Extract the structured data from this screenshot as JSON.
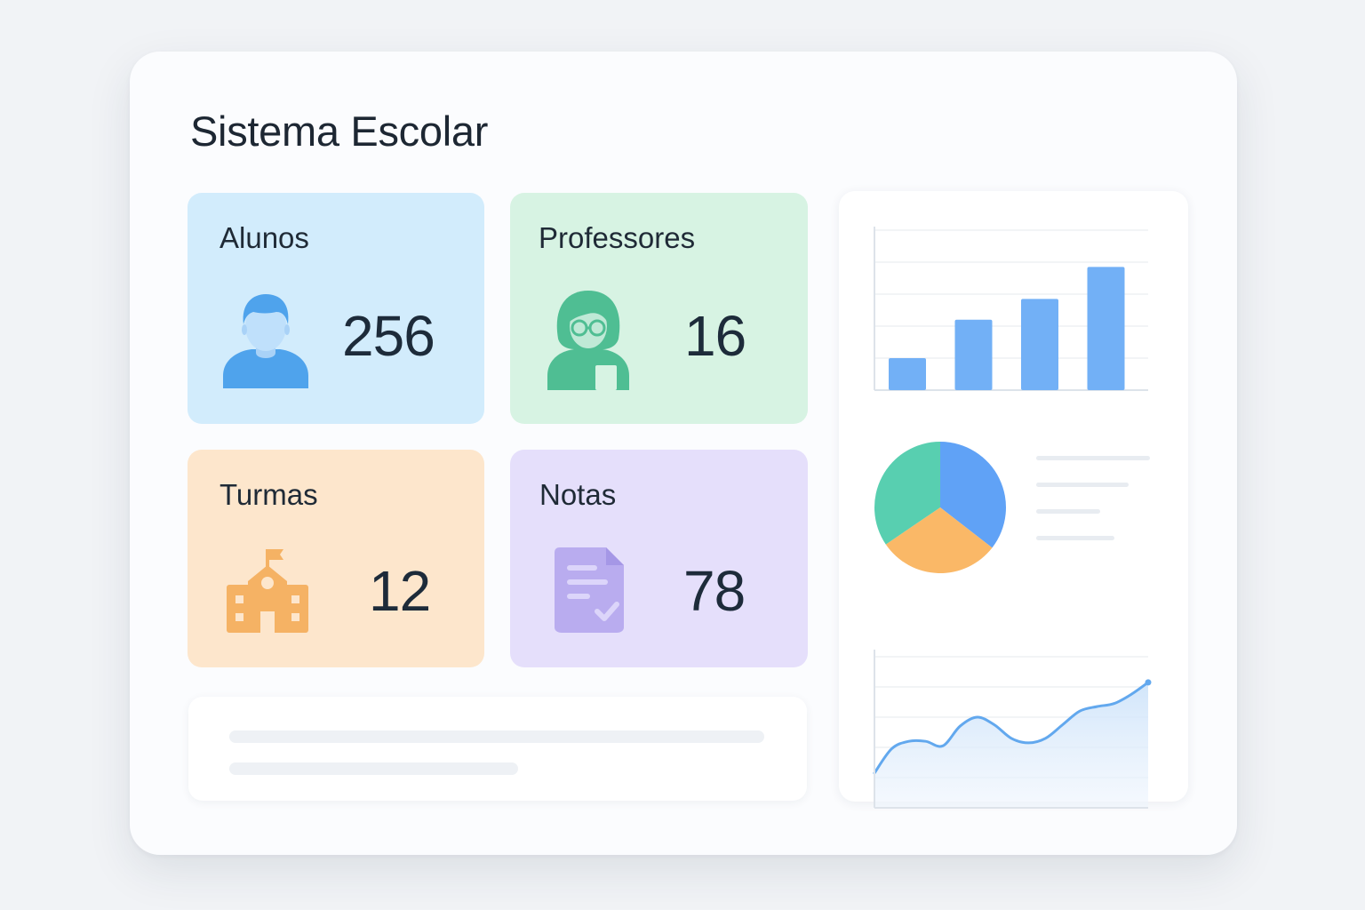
{
  "app": {
    "title": "Sistema Escolar"
  },
  "stats": [
    {
      "label": "Alunos",
      "value": "256",
      "icon": "student-icon",
      "bg": "#d2ecfc",
      "accent": "#4fa3ec"
    },
    {
      "label": "Professores",
      "value": "16",
      "icon": "teacher-icon",
      "bg": "#d7f3e3",
      "accent": "#4fbe93"
    },
    {
      "label": "Turmas",
      "value": "12",
      "icon": "school-icon",
      "bg": "#fde6cc",
      "accent": "#f5b264"
    },
    {
      "label": "Notas",
      "value": "78",
      "icon": "document-check-icon",
      "bg": "#e5dffb",
      "accent": "#b9acef"
    }
  ],
  "chart_data": [
    {
      "type": "bar",
      "categories": [
        "",
        "",
        "",
        ""
      ],
      "values": [
        20,
        44,
        57,
        77
      ],
      "ylim": [
        0,
        100
      ],
      "grid": true,
      "colors": [
        "#72b0f6"
      ]
    },
    {
      "type": "pie",
      "categories": [
        "",
        "",
        ""
      ],
      "values": [
        35.5,
        30,
        34.5
      ],
      "colors": [
        "#60a2f6",
        "#fab867",
        "#58cfb0"
      ],
      "legend": "right"
    },
    {
      "type": "area",
      "x": [
        0,
        1,
        2,
        3,
        4,
        5,
        6,
        7,
        8,
        9,
        10,
        11,
        12,
        13,
        14,
        15,
        16
      ],
      "values": [
        23,
        39,
        44,
        44,
        41,
        54,
        60,
        55,
        46,
        43,
        46,
        55,
        64,
        67,
        69,
        75,
        83
      ],
      "ylim": [
        0,
        100
      ],
      "grid": true,
      "colors": [
        "#62a8ee"
      ]
    }
  ]
}
